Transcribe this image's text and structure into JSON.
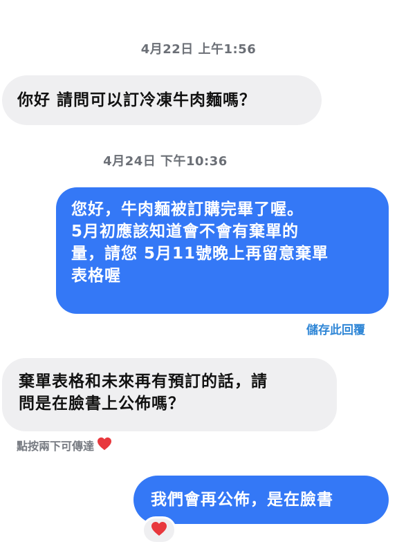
{
  "messages": [
    {
      "type": "timestamp",
      "text": "4月22日 上午1:56"
    },
    {
      "type": "incoming",
      "text": "你好 請問可以訂冷凍牛肉麵嗎？"
    },
    {
      "type": "timestamp",
      "text": "4月24日 下午10:36"
    },
    {
      "type": "outgoing",
      "text": "您好，牛肉麵被訂購完畢了喔。\n5月初應該知道會不會有棄單的\n量，請您 5月11號晚上再留意棄單\n表格喔"
    },
    {
      "type": "action",
      "text": "儲存此回覆"
    },
    {
      "type": "incoming",
      "text": "棄單表格和未來再有預訂的話，請\n問是在臉書上公佈嗎？"
    },
    {
      "type": "hint",
      "text": "點按兩下可傳達"
    },
    {
      "type": "outgoing",
      "text": "我們會再公佈，是在臉書"
    }
  ],
  "reaction": {
    "icon": "heart-icon",
    "color": "#e8383d"
  },
  "colors": {
    "incoming_bg": "#efeff1",
    "outgoing_bg": "#3478f6",
    "timestamp": "#6b6f76",
    "link": "#2f86d6",
    "heart": "#e8383d"
  }
}
